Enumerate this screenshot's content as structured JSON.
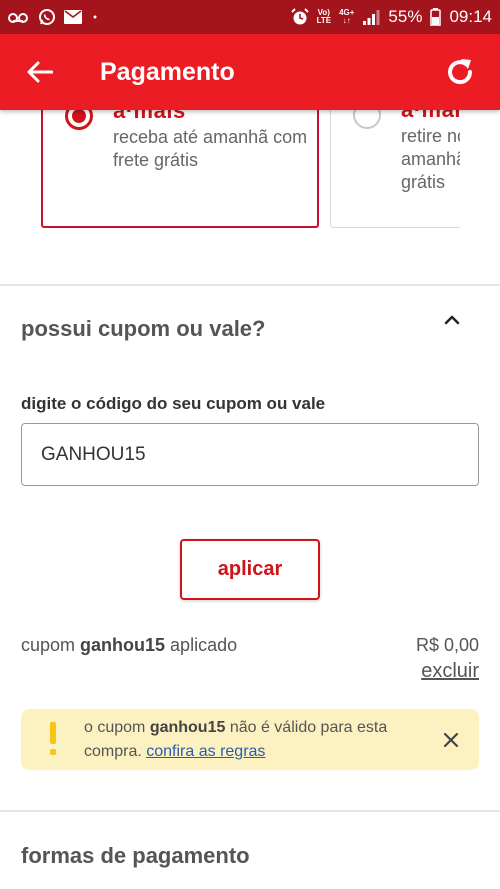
{
  "status_bar": {
    "voice_label": "Vo)",
    "lte_label": "LTE",
    "net_label": "4G+",
    "battery": "55%",
    "time": "09:14"
  },
  "app_bar": {
    "title": "Pagamento"
  },
  "shipping": {
    "options": [
      {
        "brand": "a·mais",
        "description": "receba até amanhã com frete grátis",
        "selected": true
      },
      {
        "brand": "a·mais",
        "description": "retire no de amanhã frete grátis",
        "selected": false
      }
    ],
    "option2_visible": "retire n\nde ama\nfrete g"
  },
  "cupom": {
    "title": "possui cupom ou vale?",
    "field_label": "digite o código do seu cupom ou vale",
    "input_value": "GANHOU15",
    "apply_label": "aplicar",
    "applied_prefix": "cupom ",
    "applied_code": "ganhou15",
    "applied_suffix": " aplicado",
    "applied_value": "R$ 0,00",
    "remove_label": "excluir"
  },
  "alert": {
    "prefix": "o cupom ",
    "code": "ganhou15",
    "middle": " não é válido para esta compra. ",
    "link": "confira as regras"
  },
  "payment": {
    "title": "formas de pagamento"
  },
  "colors": {
    "status_bar": "#a3141d",
    "app_bar": "#ec1c24",
    "accent": "#d0121b",
    "alert_bg": "#fcf1c1",
    "warning": "#f5c518",
    "link": "#2a5db0"
  }
}
